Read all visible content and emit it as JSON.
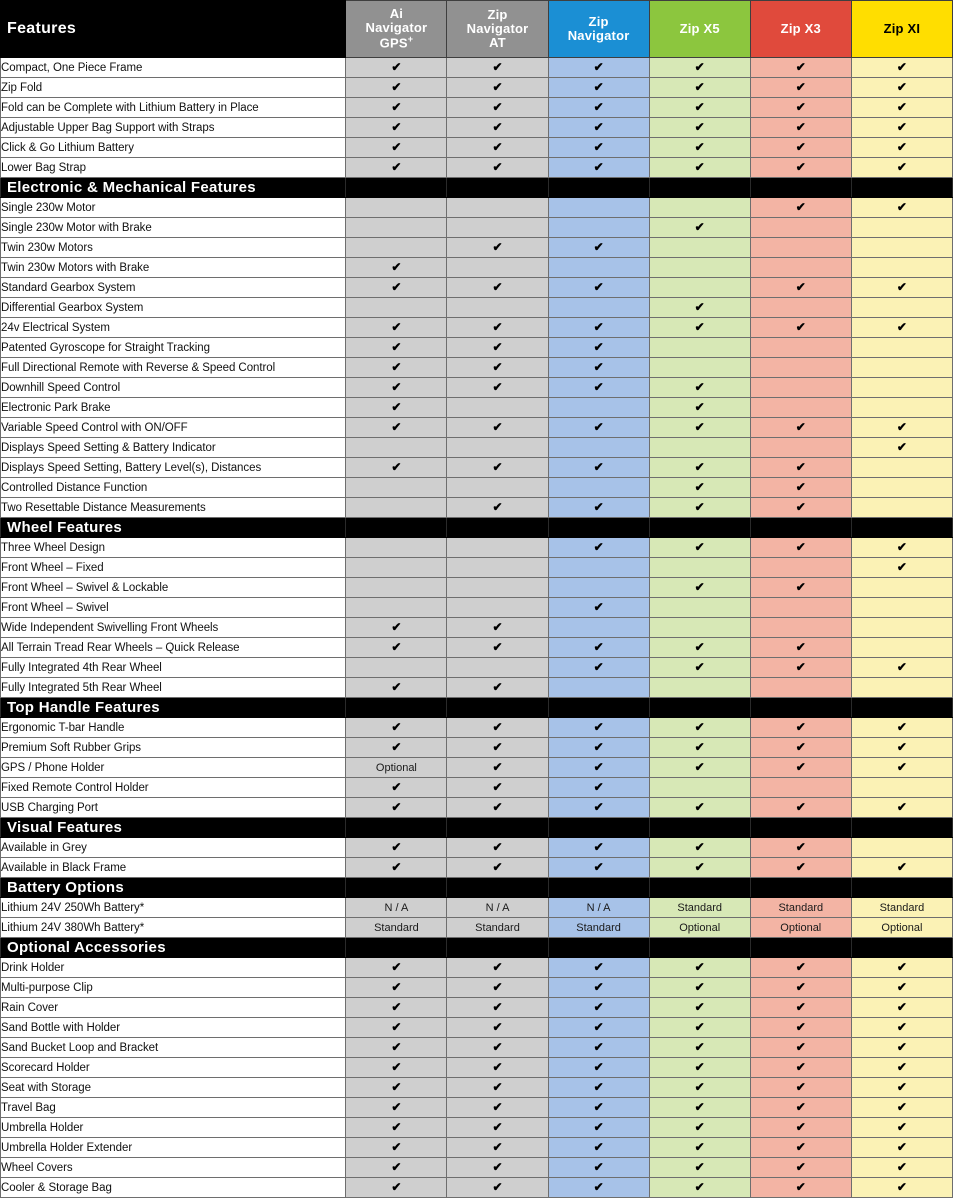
{
  "header": {
    "features_label": "Features",
    "models": [
      {
        "name": "Ai Navigator GPS+",
        "lines": [
          "Ai",
          "Navigator",
          "GPS"
        ],
        "sup": "+",
        "bg": "#919191",
        "fg": "#ffffff"
      },
      {
        "name": "Zip Navigator AT",
        "lines": [
          "Zip",
          "Navigator",
          "AT"
        ],
        "sup": "",
        "bg": "#919191",
        "fg": "#ffffff"
      },
      {
        "name": "Zip Navigator",
        "lines": [
          "Zip",
          "Navigator"
        ],
        "sup": "",
        "bg": "#1b8fd4",
        "fg": "#ffffff"
      },
      {
        "name": "Zip X5",
        "lines": [
          "Zip X5"
        ],
        "sup": "",
        "bg": "#8cc63e",
        "fg": "#ffffff"
      },
      {
        "name": "Zip X3",
        "lines": [
          "Zip X3"
        ],
        "sup": "",
        "bg": "#e04a3c",
        "fg": "#ffffff"
      },
      {
        "name": "Zip XI",
        "lines": [
          "Zip XI"
        ],
        "sup": "",
        "bg": "#ffde00",
        "fg": "#000000"
      }
    ]
  },
  "cell_colors": {
    "m0": "#cfcfcf",
    "m1": "#cfcfcf",
    "m2": "#a7c2e8",
    "m3": "#d7e8b6",
    "m4": "#f3b4a4",
    "m5": "#fbf2b5"
  },
  "check_glyph": "✔",
  "sections": [
    {
      "title": "",
      "rows": [
        {
          "label": "Compact, One Piece Frame",
          "values": [
            "check",
            "check",
            "check",
            "check",
            "check",
            "check"
          ]
        },
        {
          "label": "Zip Fold",
          "values": [
            "check",
            "check",
            "check",
            "check",
            "check",
            "check"
          ]
        },
        {
          "label": "Fold can be Complete with Lithium Battery in Place",
          "values": [
            "check",
            "check",
            "check",
            "check",
            "check",
            "check"
          ]
        },
        {
          "label": "Adjustable Upper Bag Support with Straps",
          "values": [
            "check",
            "check",
            "check",
            "check",
            "check",
            "check"
          ]
        },
        {
          "label": "Click & Go Lithium Battery",
          "values": [
            "check",
            "check",
            "check",
            "check",
            "check",
            "check"
          ]
        },
        {
          "label": "Lower Bag Strap",
          "values": [
            "check",
            "check",
            "check",
            "check",
            "check",
            "check"
          ]
        }
      ]
    },
    {
      "title": "Electronic & Mechanical Features",
      "rows": [
        {
          "label": "Single 230w Motor",
          "values": [
            "",
            "",
            "",
            "",
            "check",
            "check"
          ]
        },
        {
          "label": "Single 230w Motor with Brake",
          "values": [
            "",
            "",
            "",
            "check",
            "",
            ""
          ]
        },
        {
          "label": "Twin 230w Motors",
          "values": [
            "",
            "check",
            "check",
            "",
            "",
            ""
          ]
        },
        {
          "label": "Twin 230w Motors with Brake",
          "values": [
            "check",
            "",
            "",
            "",
            "",
            ""
          ]
        },
        {
          "label": "Standard Gearbox System",
          "values": [
            "check",
            "check",
            "check",
            "",
            "check",
            "check"
          ]
        },
        {
          "label": "Differential Gearbox System",
          "values": [
            "",
            "",
            "",
            "check",
            "",
            ""
          ]
        },
        {
          "label": "24v Electrical System",
          "values": [
            "check",
            "check",
            "check",
            "check",
            "check",
            "check"
          ]
        },
        {
          "label": "Patented Gyroscope for Straight Tracking",
          "values": [
            "check",
            "check",
            "check",
            "",
            "",
            ""
          ]
        },
        {
          "label": "Full Directional Remote with Reverse & Speed Control",
          "values": [
            "check",
            "check",
            "check",
            "",
            "",
            ""
          ]
        },
        {
          "label": "Downhill Speed Control",
          "values": [
            "check",
            "check",
            "check",
            "check",
            "",
            ""
          ]
        },
        {
          "label": "Electronic Park Brake",
          "values": [
            "check",
            "",
            "",
            "check",
            "",
            ""
          ]
        },
        {
          "label": "Variable Speed Control with ON/OFF",
          "values": [
            "check",
            "check",
            "check",
            "check",
            "check",
            "check"
          ]
        },
        {
          "label": "Displays Speed Setting & Battery Indicator",
          "values": [
            "",
            "",
            "",
            "",
            "",
            "check"
          ]
        },
        {
          "label": "Displays Speed Setting, Battery Level(s), Distances",
          "values": [
            "check",
            "check",
            "check",
            "check",
            "check",
            ""
          ]
        },
        {
          "label": "Controlled Distance Function",
          "values": [
            "",
            "",
            "",
            "check",
            "check",
            ""
          ]
        },
        {
          "label": "Two Resettable Distance Measurements",
          "values": [
            "",
            "check",
            "check",
            "check",
            "check",
            ""
          ]
        }
      ]
    },
    {
      "title": "Wheel Features",
      "rows": [
        {
          "label": "Three Wheel Design",
          "values": [
            "",
            "",
            "check",
            "check",
            "check",
            "check"
          ]
        },
        {
          "label": "Front Wheel – Fixed",
          "values": [
            "",
            "",
            "",
            "",
            "",
            "check"
          ]
        },
        {
          "label": "Front Wheel – Swivel & Lockable",
          "values": [
            "",
            "",
            "",
            "check",
            "check",
            ""
          ]
        },
        {
          "label": "Front Wheel – Swivel",
          "values": [
            "",
            "",
            "check",
            "",
            "",
            ""
          ]
        },
        {
          "label": "Wide Independent Swivelling Front Wheels",
          "values": [
            "check",
            "check",
            "",
            "",
            "",
            ""
          ]
        },
        {
          "label": "All Terrain Tread Rear Wheels – Quick Release",
          "values": [
            "check",
            "check",
            "check",
            "check",
            "check",
            ""
          ]
        },
        {
          "label": "Fully Integrated 4th Rear Wheel",
          "values": [
            "",
            "",
            "check",
            "check",
            "check",
            "check"
          ]
        },
        {
          "label": "Fully Integrated 5th Rear Wheel",
          "values": [
            "check",
            "check",
            "",
            "",
            "",
            ""
          ]
        }
      ]
    },
    {
      "title": "Top Handle Features",
      "rows": [
        {
          "label": "Ergonomic T-bar Handle",
          "values": [
            "check",
            "check",
            "check",
            "check",
            "check",
            "check"
          ]
        },
        {
          "label": "Premium Soft Rubber Grips",
          "values": [
            "check",
            "check",
            "check",
            "check",
            "check",
            "check"
          ]
        },
        {
          "label": "GPS / Phone Holder",
          "values": [
            "Optional",
            "check",
            "check",
            "check",
            "check",
            "check"
          ]
        },
        {
          "label": "Fixed Remote Control Holder",
          "values": [
            "check",
            "check",
            "check",
            "",
            "",
            ""
          ]
        },
        {
          "label": "USB Charging Port",
          "values": [
            "check",
            "check",
            "check",
            "check",
            "check",
            "check"
          ]
        }
      ]
    },
    {
      "title": "Visual Features",
      "rows": [
        {
          "label": "Available in Grey",
          "values": [
            "check",
            "check",
            "check",
            "check",
            "check",
            ""
          ]
        },
        {
          "label": "Available in Black Frame",
          "values": [
            "check",
            "check",
            "check",
            "check",
            "check",
            "check"
          ]
        }
      ]
    },
    {
      "title": "Battery Options",
      "rows": [
        {
          "label": "Lithium 24V 250Wh Battery*",
          "values": [
            "N / A",
            "N / A",
            "N / A",
            "Standard",
            "Standard",
            "Standard"
          ]
        },
        {
          "label": "Lithium 24V 380Wh Battery*",
          "values": [
            "Standard",
            "Standard",
            "Standard",
            "Optional",
            "Optional",
            "Optional"
          ]
        }
      ]
    },
    {
      "title": "Optional Accessories",
      "rows": [
        {
          "label": "Drink Holder",
          "values": [
            "check",
            "check",
            "check",
            "check",
            "check",
            "check"
          ]
        },
        {
          "label": "Multi-purpose Clip",
          "values": [
            "check",
            "check",
            "check",
            "check",
            "check",
            "check"
          ]
        },
        {
          "label": "Rain Cover",
          "values": [
            "check",
            "check",
            "check",
            "check",
            "check",
            "check"
          ]
        },
        {
          "label": "Sand Bottle with Holder",
          "values": [
            "check",
            "check",
            "check",
            "check",
            "check",
            "check"
          ]
        },
        {
          "label": "Sand Bucket Loop and Bracket",
          "values": [
            "check",
            "check",
            "check",
            "check",
            "check",
            "check"
          ]
        },
        {
          "label": "Scorecard Holder",
          "values": [
            "check",
            "check",
            "check",
            "check",
            "check",
            "check"
          ]
        },
        {
          "label": "Seat with Storage",
          "values": [
            "check",
            "check",
            "check",
            "check",
            "check",
            "check"
          ]
        },
        {
          "label": "Travel Bag",
          "values": [
            "check",
            "check",
            "check",
            "check",
            "check",
            "check"
          ]
        },
        {
          "label": "Umbrella Holder",
          "values": [
            "check",
            "check",
            "check",
            "check",
            "check",
            "check"
          ]
        },
        {
          "label": "Umbrella Holder Extender",
          "values": [
            "check",
            "check",
            "check",
            "check",
            "check",
            "check"
          ]
        },
        {
          "label": "Wheel Covers",
          "values": [
            "check",
            "check",
            "check",
            "check",
            "check",
            "check"
          ]
        },
        {
          "label": "Cooler & Storage Bag",
          "values": [
            "check",
            "check",
            "check",
            "check",
            "check",
            "check"
          ]
        }
      ]
    }
  ]
}
